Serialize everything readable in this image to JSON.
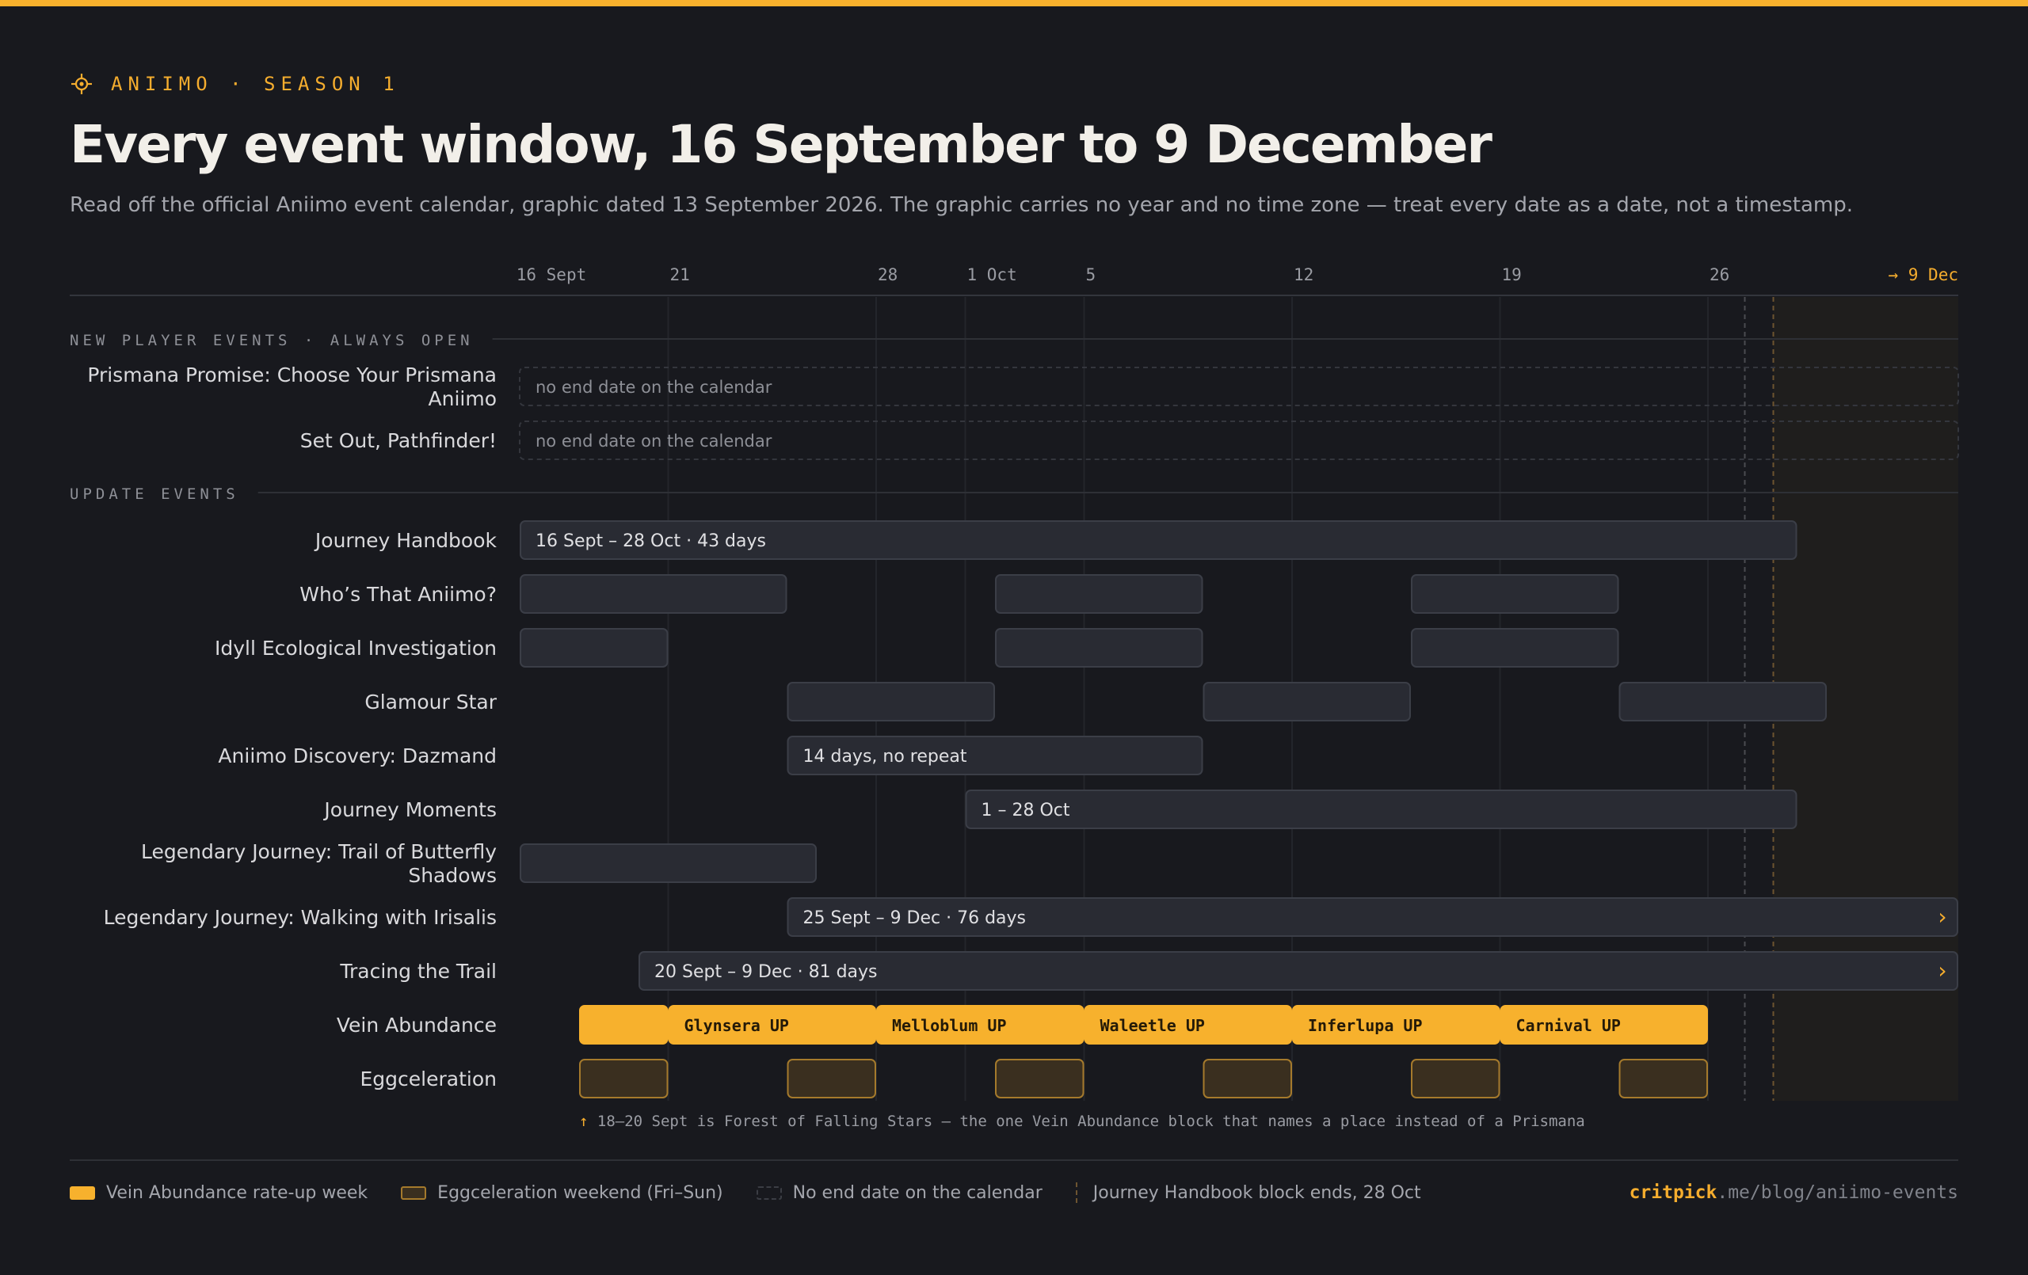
{
  "header": {
    "kicker": "ANIIMO · SEASON 1",
    "title": "Every event window, 16 September to 9 December",
    "subtitle": "Read off the official Aniimo event calendar, graphic dated 13 September 2026. The graphic carries no year and no time zone — treat every date as a date, not a timestamp."
  },
  "colors": {
    "accent": "#f5ad2e",
    "vein": "#f7b12d",
    "bar": "#292b33",
    "bar_border": "#3b3e47",
    "egg_fill": "#3a2f1f",
    "egg_border": "#a57a2c",
    "background": "#18191e"
  },
  "chart_data": {
    "type": "gantt",
    "x_axis": {
      "type": "date",
      "range": [
        "16 Sept",
        "9 Dec"
      ],
      "ticks": [
        {
          "date": "16 Sept",
          "label": "16 Sept"
        },
        {
          "date": "21 Sept",
          "label": "21"
        },
        {
          "date": "28 Sept",
          "label": "28"
        },
        {
          "date": "1 Oct",
          "label": "1 Oct"
        },
        {
          "date": "5 Oct",
          "label": "5"
        },
        {
          "date": "12 Oct",
          "label": "12"
        },
        {
          "date": "19 Oct",
          "label": "19"
        },
        {
          "date": "26 Oct",
          "label": "26"
        },
        {
          "date": "9 Dec",
          "label": "→ 9 Dec",
          "accent": true
        }
      ]
    },
    "sections": [
      {
        "title": "NEW PLAYER EVENTS · ALWAYS OPEN",
        "rows": [
          {
            "name": "Prismana Promise: Choose Your Prismana Aniimo",
            "label_lines": [
              "Prismana Promise: Choose Your Prismana",
              "Aniimo"
            ],
            "open_ended": true,
            "note": "no end date on the calendar"
          },
          {
            "name": "Set Out, Pathfinder!",
            "open_ended": true,
            "note": "no end date on the calendar"
          }
        ]
      },
      {
        "title": "UPDATE EVENTS",
        "rows": [
          {
            "name": "Journey Handbook",
            "bars": [
              {
                "start": "16 Sept",
                "end": "28 Oct",
                "label": "16 Sept – 28 Oct · 43 days"
              }
            ]
          },
          {
            "name": "Who’s That Aniimo?",
            "bars": [
              {
                "start": "16 Sept",
                "end": "24 Sept"
              },
              {
                "start": "2 Oct",
                "end": "8 Oct"
              },
              {
                "start": "16 Oct",
                "end": "22 Oct"
              }
            ]
          },
          {
            "name": "Idyll Ecological Investigation",
            "bars": [
              {
                "start": "16 Sept",
                "end": "20 Sept"
              },
              {
                "start": "2 Oct",
                "end": "8 Oct"
              },
              {
                "start": "16 Oct",
                "end": "22 Oct"
              }
            ]
          },
          {
            "name": "Glamour Star",
            "bars": [
              {
                "start": "25 Sept",
                "end": "1 Oct"
              },
              {
                "start": "9 Oct",
                "end": "15 Oct"
              },
              {
                "start": "23 Oct",
                "end": "29 Oct"
              }
            ]
          },
          {
            "name": "Aniimo Discovery: Dazmand",
            "bars": [
              {
                "start": "25 Sept",
                "end": "8 Oct",
                "label": "14 days, no repeat"
              }
            ]
          },
          {
            "name": "Journey Moments",
            "bars": [
              {
                "start": "1 Oct",
                "end": "28 Oct",
                "label": "1 – 28 Oct"
              }
            ]
          },
          {
            "name": "Legendary Journey: Trail of Butterfly Shadows",
            "label_lines": [
              "Legendary Journey: Trail of Butterfly",
              "Shadows"
            ],
            "bars": [
              {
                "start": "16 Sept",
                "end": "25 Sept"
              }
            ]
          },
          {
            "name": "Legendary Journey: Walking with Irisalis",
            "bars": [
              {
                "start": "25 Sept",
                "end": "9 Dec",
                "label": "25 Sept – 9 Dec · 76 days",
                "continues": true
              }
            ]
          },
          {
            "name": "Tracing the Trail",
            "bars": [
              {
                "start": "20 Sept",
                "end": "9 Dec",
                "label": "20 Sept – 9 Dec · 81 days",
                "continues": true
              }
            ]
          },
          {
            "name": "Vein Abundance",
            "style": "vein",
            "bars": [
              {
                "start": "18 Sept",
                "end": "20 Sept",
                "label": ""
              },
              {
                "start": "21 Sept",
                "end": "27 Sept",
                "label": "Glynsera UP"
              },
              {
                "start": "28 Sept",
                "end": "4 Oct",
                "label": "Melloblum UP"
              },
              {
                "start": "5 Oct",
                "end": "11 Oct",
                "label": "Waleetle UP"
              },
              {
                "start": "12 Oct",
                "end": "18 Oct",
                "label": "Inferlupa UP"
              },
              {
                "start": "19 Oct",
                "end": "25 Oct",
                "label": "Carnival UP"
              }
            ]
          },
          {
            "name": "Eggceleration",
            "style": "egg",
            "bars": [
              {
                "start": "18 Sept",
                "end": "20 Sept"
              },
              {
                "start": "25 Sept",
                "end": "27 Sept"
              },
              {
                "start": "2 Oct",
                "end": "4 Oct"
              },
              {
                "start": "9 Oct",
                "end": "11 Oct"
              },
              {
                "start": "16 Oct",
                "end": "18 Oct"
              },
              {
                "start": "23 Oct",
                "end": "25 Oct"
              }
            ]
          }
        ]
      }
    ],
    "reference_lines": [
      {
        "date": "28 Oct",
        "meaning": "Journey Handbook block ends, 28 Oct"
      }
    ],
    "annotation": {
      "arrow": "↑",
      "text": "18–20 Sept is Forest of Falling Stars — the one Vein Abundance block that names a place instead of a Prismana"
    }
  },
  "legend": [
    {
      "type": "vein",
      "label": "Vein Abundance rate-up week"
    },
    {
      "type": "egg",
      "label": "Eggceleration weekend (Fri–Sun)"
    },
    {
      "type": "open",
      "label": "No end date on the calendar"
    },
    {
      "type": "end",
      "label": "Journey Handbook block ends, 28 Oct"
    }
  ],
  "footer": {
    "source_domain": "critpick",
    "source_path": ".me/blog/aniimo-events"
  }
}
